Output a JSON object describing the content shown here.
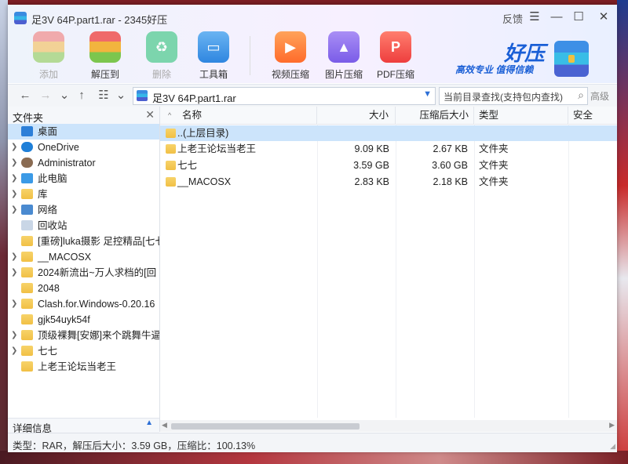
{
  "window": {
    "title": "足3V 64P.part1.rar - 2345好压",
    "feedback": "反馈",
    "menu_icon": "menu-icon",
    "minimize_icon": "minimize-icon",
    "maximize_icon": "maximize-icon",
    "close_icon": "close-icon"
  },
  "toolbar": {
    "add": "添加",
    "extract": "解压到",
    "delete": "删除",
    "tools": "工具箱",
    "video": "视频压缩",
    "image": "图片压缩",
    "pdf": "PDF压缩"
  },
  "brand": {
    "name": "好压",
    "slogan": "高效专业  值得信赖"
  },
  "address": {
    "path": "足3V 64P.part1.rar",
    "search_placeholder": "当前目录查找(支持包内查找)",
    "advanced": "高级"
  },
  "sidebar": {
    "header": "文件夹",
    "items": [
      {
        "label": "桌面",
        "icon": "desktop-icon",
        "expandable": false
      },
      {
        "label": "OneDrive",
        "icon": "cloud-icon",
        "expandable": true
      },
      {
        "label": "Administrator",
        "icon": "user-icon",
        "expandable": true
      },
      {
        "label": "此电脑",
        "icon": "computer-icon",
        "expandable": true
      },
      {
        "label": "库",
        "icon": "library-icon",
        "expandable": true
      },
      {
        "label": "网络",
        "icon": "network-icon",
        "expandable": true
      },
      {
        "label": "回收站",
        "icon": "recycle-bin-icon",
        "expandable": false
      },
      {
        "label": "[重磅]luka摄影 足控精品[七七",
        "icon": "folder-icon",
        "expandable": false
      },
      {
        "label": "__MACOSX",
        "icon": "folder-icon",
        "expandable": true
      },
      {
        "label": "2024新流出~万人求档的[回",
        "icon": "folder-icon",
        "expandable": true
      },
      {
        "label": "2048",
        "icon": "folder-icon",
        "expandable": false
      },
      {
        "label": "Clash.for.Windows-0.20.16",
        "icon": "folder-icon",
        "expandable": true
      },
      {
        "label": "gjk54uyk54f",
        "icon": "folder-icon",
        "expandable": false
      },
      {
        "label": "顶级裸舞[安娜]来个跳舞牛逼",
        "icon": "folder-icon",
        "expandable": true
      },
      {
        "label": "七七",
        "icon": "folder-icon",
        "expandable": true
      },
      {
        "label": "上老王论坛当老王",
        "icon": "folder-icon",
        "expandable": false
      }
    ],
    "footer": "详细信息"
  },
  "filelist": {
    "columns": [
      "名称",
      "大小",
      "压缩后大小",
      "类型",
      "安全"
    ],
    "rows": [
      {
        "name": "..(上层目录)",
        "size": "",
        "packed": "",
        "type": ""
      },
      {
        "name": "上老王论坛当老王",
        "size": "9.09 KB",
        "packed": "2.67 KB",
        "type": "文件夹"
      },
      {
        "name": "七七",
        "size": "3.59 GB",
        "packed": "3.60 GB",
        "type": "文件夹"
      },
      {
        "name": "__MACOSX",
        "size": "2.83 KB",
        "packed": "2.18 KB",
        "type": "文件夹"
      }
    ]
  },
  "status": {
    "text": "类型：RAR，解压后大小：3.59 GB，压缩比：100.13%"
  }
}
